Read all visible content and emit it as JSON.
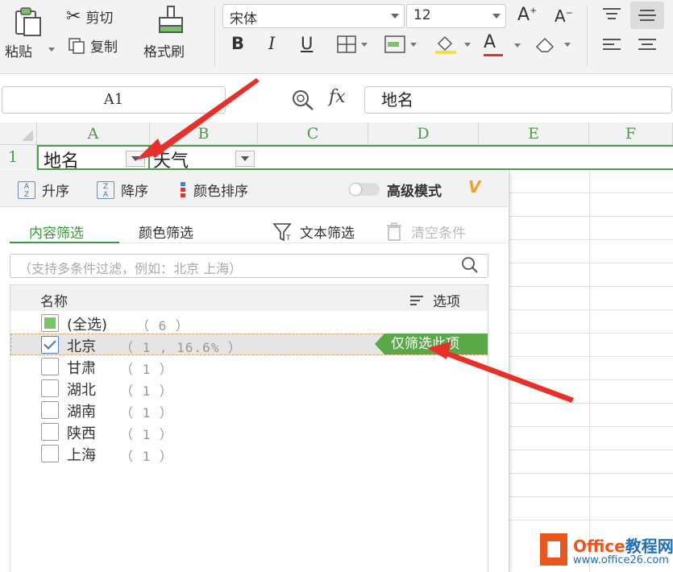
{
  "ribbon": {
    "paste_label": "粘贴",
    "cut_label": "剪切",
    "copy_label": "复制",
    "format_painter_label": "格式刷",
    "font_name": "宋体",
    "font_size": "12",
    "bold": "B",
    "italic": "I",
    "underline": "U",
    "font_color_glyph": "A"
  },
  "formula_bar": {
    "cell_ref": "A1",
    "fx_label": "fx",
    "content": "地名"
  },
  "grid": {
    "columns": [
      "A",
      "B",
      "C",
      "D",
      "E",
      "F"
    ],
    "row_number": "1",
    "cell_a1": "地名",
    "cell_b1": "天气"
  },
  "filter_panel": {
    "sort_asc": "升序",
    "sort_desc": "降序",
    "color_sort": "颜色排序",
    "advanced_mode": "高级模式",
    "vip_badge": "V",
    "tab_content": "内容筛选",
    "tab_color": "颜色筛选",
    "text_filter": "文本筛选",
    "clear_conditions": "清空条件",
    "search_placeholder": "（支持多条件过滤，例如：北京 上海）",
    "list_header_name": "名称",
    "list_header_options": "选项",
    "only_this_label": "仅筛选此项",
    "items": [
      {
        "label": "(全选)",
        "count": "（ 6 ）",
        "state": "partial"
      },
      {
        "label": "北京",
        "count": "（ 1 , 16.6% ）",
        "state": "checked"
      },
      {
        "label": "甘肃",
        "count": "（ 1 ）",
        "state": "unchecked"
      },
      {
        "label": "湖北",
        "count": "（ 1 ）",
        "state": "unchecked"
      },
      {
        "label": "湖南",
        "count": "（ 1 ）",
        "state": "unchecked"
      },
      {
        "label": "陕西",
        "count": "（ 1 ）",
        "state": "unchecked"
      },
      {
        "label": "上海",
        "count": "（ 1 ）",
        "state": "unchecked"
      }
    ]
  },
  "watermark": {
    "brand_part1": "Office",
    "brand_part2": "教程网",
    "url": "www.office26.com"
  },
  "colors": {
    "accent_green": "#3a9a3a",
    "annotation_red": "#e8302a",
    "watermark_orange": "#e8581e",
    "watermark_blue": "#1f6fb8"
  }
}
